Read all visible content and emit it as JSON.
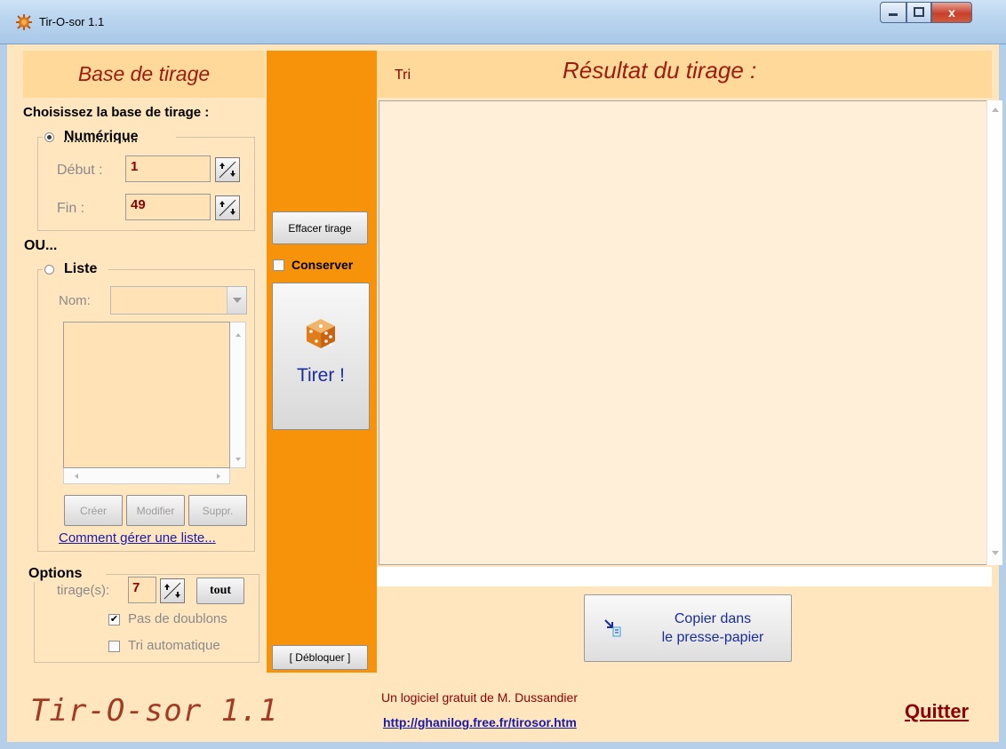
{
  "window": {
    "title": "Tir-O-sor 1.1",
    "minimize_glyph": "–",
    "maximize_glyph": "□",
    "close_glyph": "x"
  },
  "left": {
    "header": "Base de tirage",
    "choose_label": "Choisissez la base de tirage :",
    "numeric": {
      "label": "Numérique",
      "selected": true,
      "start_label": "Début :",
      "start_value": "1",
      "end_label": "Fin :",
      "end_value": "49"
    },
    "or_label": "OU...",
    "list": {
      "label": "Liste",
      "selected": false,
      "name_label": "Nom:",
      "name_value": "",
      "create_label": "Créer",
      "modify_label": "Modifier",
      "delete_label": "Suppr.",
      "help_link": "Comment gérer une liste..."
    },
    "options": {
      "title": "Options",
      "draws_label": "tirage(s):",
      "draws_value": "7",
      "all_label": "tout",
      "no_duplicates_label": "Pas de doublons",
      "no_duplicates_checked": true,
      "auto_sort_label": "Tri automatique",
      "auto_sort_checked": false
    }
  },
  "middle": {
    "clear_label": "Effacer tirage",
    "keep_label": "Conserver",
    "keep_checked": false,
    "draw_label": "Tirer !",
    "unlock_label": "[ Débloquer ]"
  },
  "right": {
    "sort_label": "Tri",
    "result_title": "Résultat du tirage :",
    "copy_line1": "Copier dans",
    "copy_line2": "le presse-papier"
  },
  "footer": {
    "brand": "Tir-O-sor 1.1",
    "credit": "Un logiciel gratuit de M. Dussandier",
    "url": "http://ghanilog.free.fr/tirosor.htm",
    "quit_label": "Quitter"
  },
  "colors": {
    "orange_column": "#f7930b",
    "header_bg": "#ffd999",
    "panel_bg": "#ffe6bf",
    "title_red": "#9b1c0e"
  }
}
